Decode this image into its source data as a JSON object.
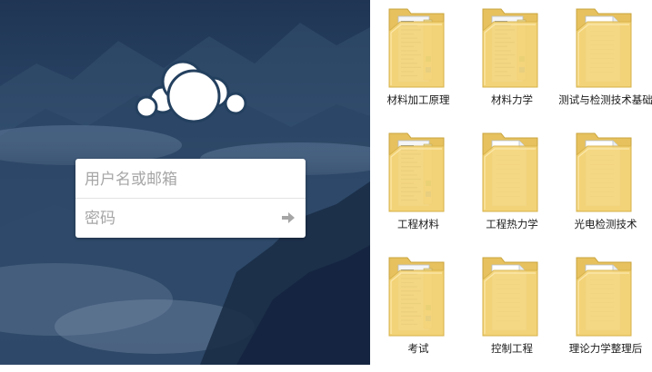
{
  "login": {
    "username_placeholder": "用户名或邮箱",
    "password_placeholder": "密码",
    "submit_icon": "arrow-right-icon",
    "logo_icon": "cloud-logo-icon"
  },
  "colors": {
    "background_top": "#1f3553",
    "background_mid": "#3a5678",
    "folder_yellow": "#f2d680",
    "folder_dark": "#d9b54d"
  },
  "folders": [
    {
      "label": "材料加工原理",
      "kind": "docs"
    },
    {
      "label": "材料力学",
      "kind": "docs"
    },
    {
      "label": "测试与检测技术基础",
      "kind": "paper"
    },
    {
      "label": "工程材料",
      "kind": "docs"
    },
    {
      "label": "工程热力学",
      "kind": "paper"
    },
    {
      "label": "光电检测技术",
      "kind": "paper"
    },
    {
      "label": "考试",
      "kind": "docs"
    },
    {
      "label": "控制工程",
      "kind": "paper"
    },
    {
      "label": "理论力学整理后",
      "kind": "paper"
    }
  ]
}
